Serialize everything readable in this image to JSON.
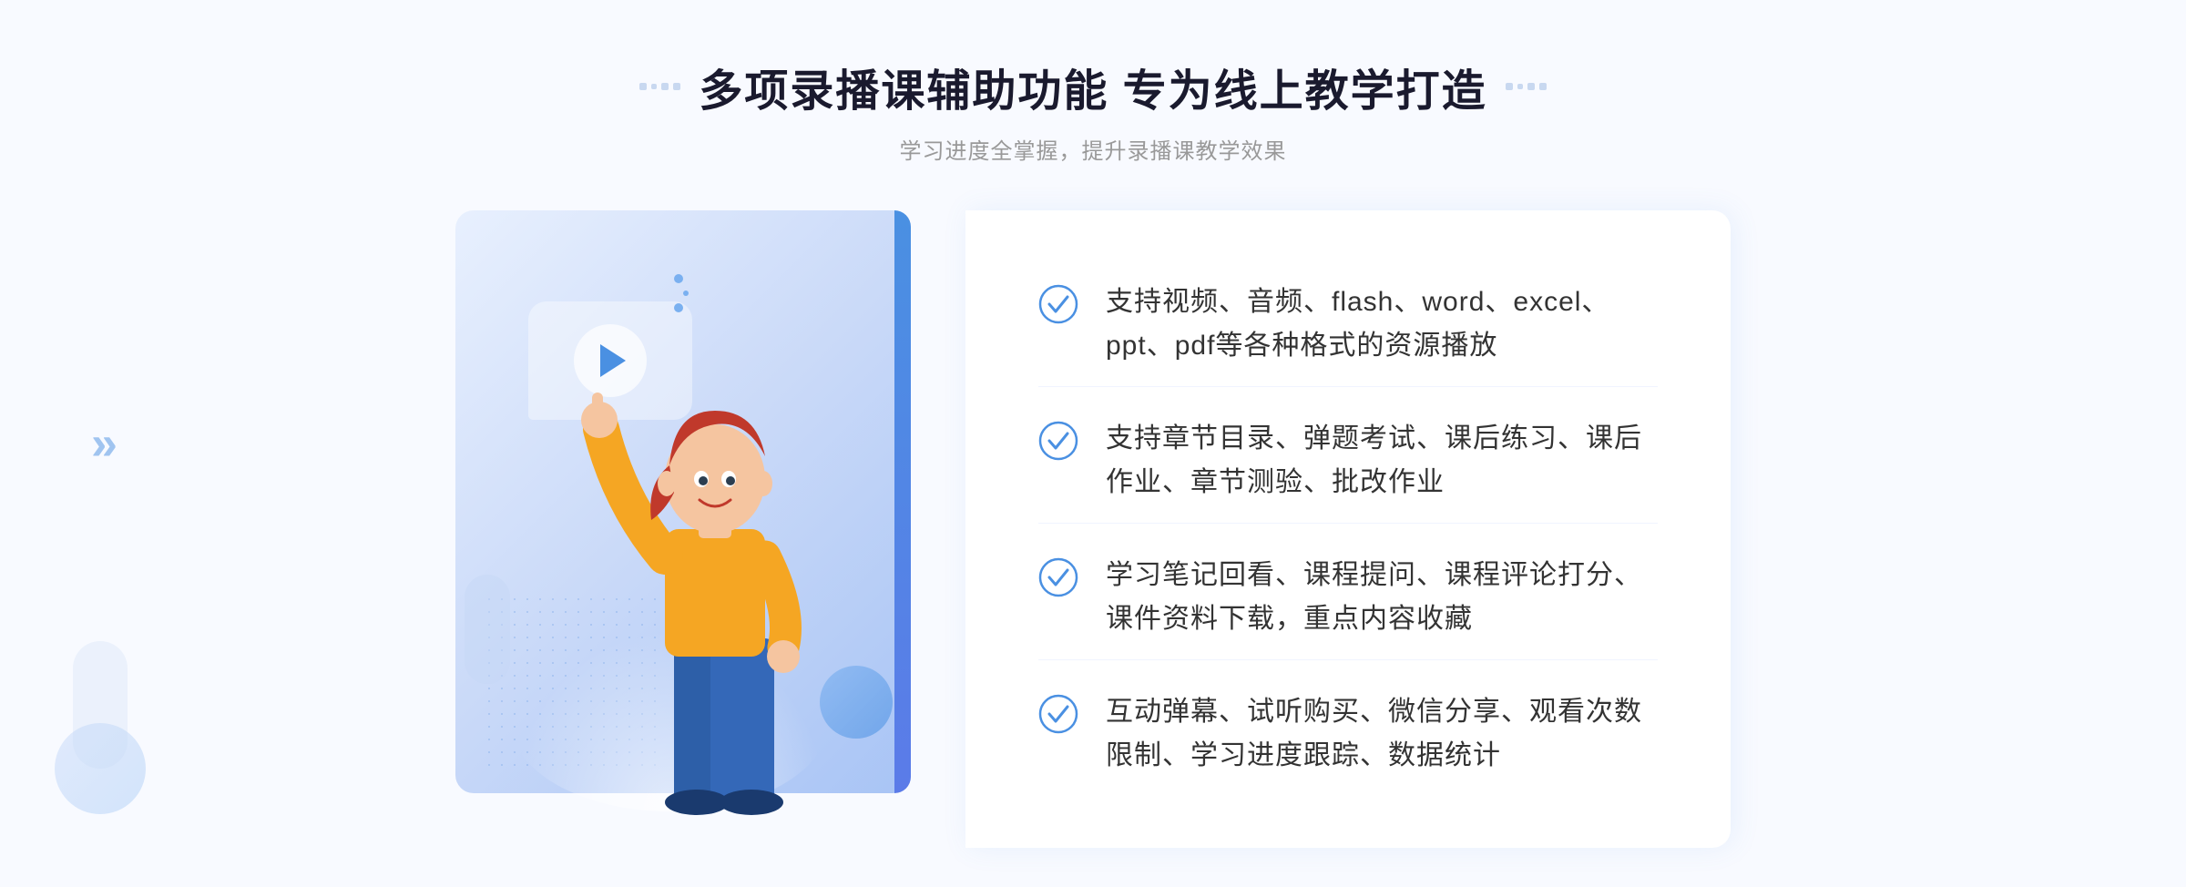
{
  "header": {
    "title": "多项录播课辅助功能 专为线上教学打造",
    "subtitle": "学习进度全掌握，提升录播课教学效果",
    "decorator_left": "❖",
    "decorator_right": "❖"
  },
  "features": [
    {
      "id": 1,
      "text": "支持视频、音频、flash、word、excel、ppt、pdf等各种格式的资源播放"
    },
    {
      "id": 2,
      "text": "支持章节目录、弹题考试、课后练习、课后作业、章节测验、批改作业"
    },
    {
      "id": 3,
      "text": "学习笔记回看、课程提问、课程评论打分、课件资料下载，重点内容收藏"
    },
    {
      "id": 4,
      "text": "互动弹幕、试听购买、微信分享、观看次数限制、学习进度跟踪、数据统计"
    }
  ],
  "colors": {
    "primary": "#4a90e2",
    "title": "#1a1a2e",
    "subtitle": "#999999",
    "text": "#333333",
    "check": "#4a90e2",
    "bg": "#f8faff"
  }
}
